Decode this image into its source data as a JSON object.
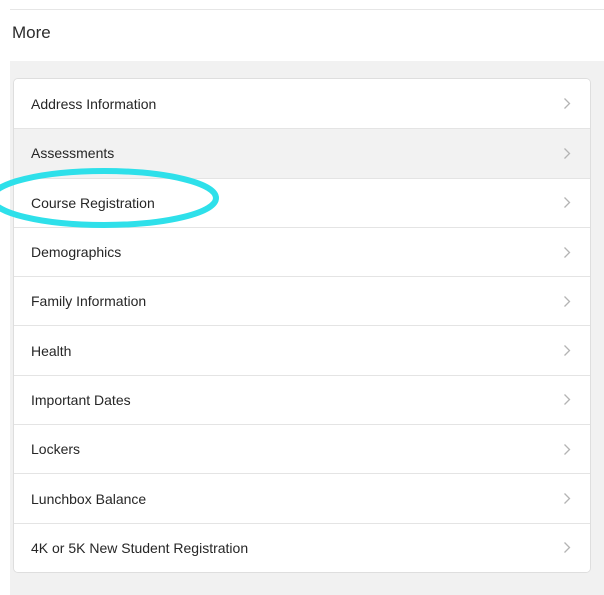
{
  "page": {
    "title": "More"
  },
  "menu": {
    "items": [
      {
        "label": "Address Information"
      },
      {
        "label": "Assessments"
      },
      {
        "label": "Course Registration"
      },
      {
        "label": "Demographics"
      },
      {
        "label": "Family Information"
      },
      {
        "label": "Health"
      },
      {
        "label": "Important Dates"
      },
      {
        "label": "Lockers"
      },
      {
        "label": "Lunchbox Balance"
      },
      {
        "label": "4K or 5K New Student Registration"
      }
    ],
    "chevron_icon": "chevron-right-icon",
    "hovered_index": 1
  },
  "colors": {
    "highlight_annotation": "#2ee0ea",
    "chevron": "#b4b4b4",
    "panel_background": "#f1f1f1"
  }
}
